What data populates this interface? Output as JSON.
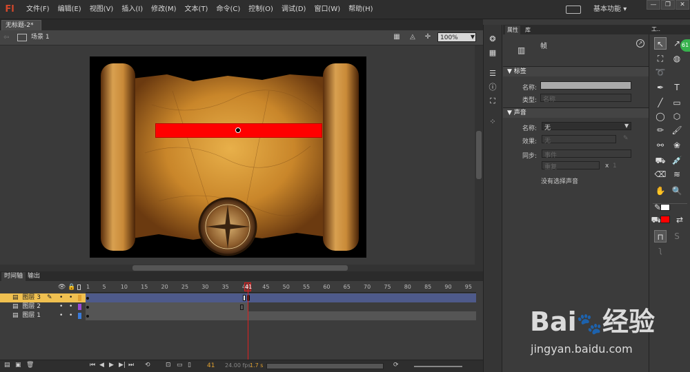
{
  "app": {
    "logo": "Fl",
    "workspace": "基本功能",
    "workspace_arrow": "▾"
  },
  "menu": [
    "文件(F)",
    "编辑(E)",
    "视图(V)",
    "插入(I)",
    "修改(M)",
    "文本(T)",
    "命令(C)",
    "控制(O)",
    "调试(D)",
    "窗口(W)",
    "帮助(H)"
  ],
  "window_controls": {
    "minimize": "—",
    "restore": "❐",
    "close": "✕"
  },
  "document": {
    "tab": "无标题-2*",
    "tab_close": "×",
    "scene": "场景 1",
    "zoom": "100%"
  },
  "timeline": {
    "tabs": [
      "时间轴",
      "输出"
    ],
    "ticks": [
      "1",
      "5",
      "10",
      "15",
      "20",
      "25",
      "30",
      "35",
      "40",
      "45",
      "50",
      "55",
      "60",
      "65",
      "70",
      "75",
      "80",
      "85",
      "90",
      "95"
    ],
    "current_frame": "41",
    "layers": [
      {
        "name": "图层 3",
        "color": "#e0a030",
        "selected": true
      },
      {
        "name": "图层 2",
        "color": "#9a4ad8",
        "selected": false
      },
      {
        "name": "图层 1",
        "color": "#3a7ad8",
        "selected": false
      }
    ],
    "status_frame": "41",
    "fps": "24.00 fps",
    "time": "1.7 s"
  },
  "properties": {
    "tabs": [
      "属性",
      "库"
    ],
    "type": "帧",
    "label_section": "标签",
    "name_label": "名称:",
    "name_value": "",
    "type_label": "类型:",
    "type_value": "名称",
    "sound_section": "声音",
    "sound_name_label": "名称:",
    "sound_name_value": "无",
    "effect_label": "效果:",
    "effect_value": "无",
    "sync_label": "同步:",
    "sync_value": "事件",
    "repeat_value": "重复",
    "repeat_times_label": "x",
    "repeat_times": "1",
    "no_sound": "没有选择声音"
  },
  "tools": {
    "header": "工..",
    "badge": "61"
  },
  "watermark": {
    "brand": "Bai",
    "brand_suffix": "经验",
    "url": "jingyan.baidu.com"
  },
  "colors": {
    "stage_object": "#ff0000",
    "fill_color": "#ff0000",
    "accent_logo": "#d4482b",
    "playhead": "#e02020"
  }
}
